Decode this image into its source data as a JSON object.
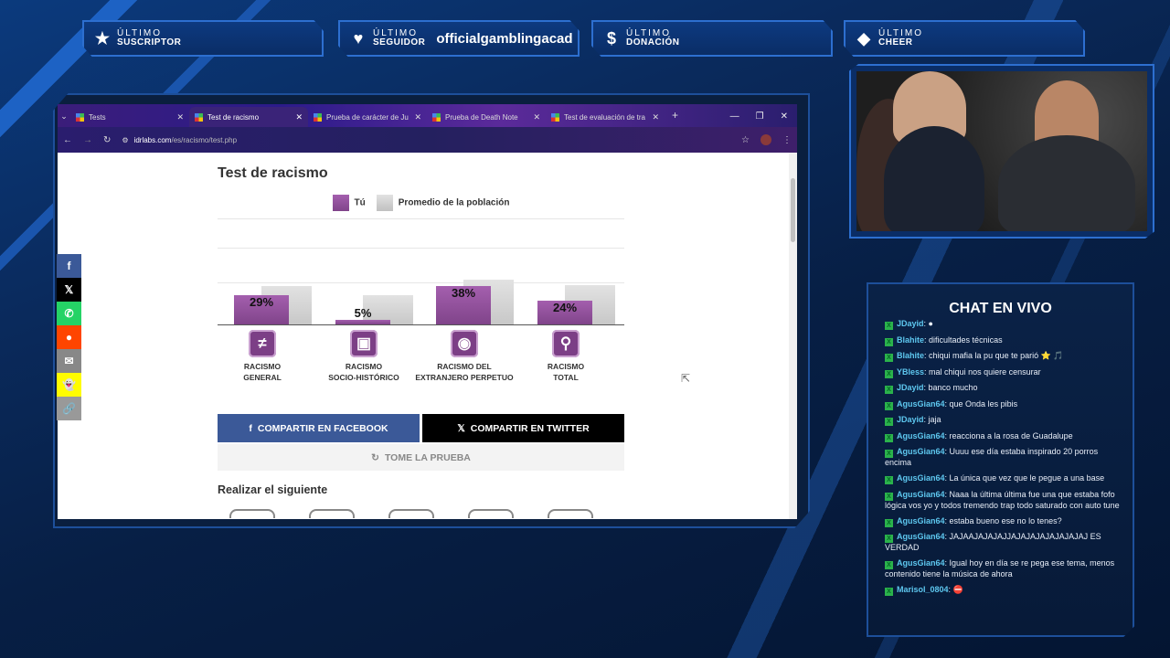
{
  "overlay": {
    "stats": [
      {
        "icon": "star-icon",
        "glyph": "★",
        "line1": "ÚLTIMO",
        "line2": "SUSCRIPTOR",
        "value": ""
      },
      {
        "icon": "heart-icon",
        "glyph": "♥",
        "line1": "ÚLTIMO",
        "line2": "SEGUIDOR",
        "value": "officialgamblingacad"
      },
      {
        "icon": "dollar-icon",
        "glyph": "$",
        "line1": "ÚLTIMO",
        "line2": "DONACIÓN",
        "value": ""
      },
      {
        "icon": "diamond-icon",
        "glyph": "◆",
        "line1": "ÚLTIMO",
        "line2": "CHEER",
        "value": ""
      }
    ]
  },
  "browser": {
    "tabs": [
      {
        "title": "Tests",
        "active": false
      },
      {
        "title": "Test de racismo",
        "active": true
      },
      {
        "title": "Prueba de carácter de Ju",
        "active": false
      },
      {
        "title": "Prueba de Death Note",
        "active": false
      },
      {
        "title": "Test de evaluación de tra",
        "active": false
      }
    ],
    "url_host": "idrlabs.com",
    "url_path": "/es/racismo/test.php"
  },
  "page": {
    "title": "Test de racismo",
    "legend_you": "Tú",
    "legend_avg": "Promedio de la población",
    "categories": [
      {
        "line1": "Racismo",
        "line2": "General",
        "icon": "not-equal-icon",
        "glyph": "≠"
      },
      {
        "line1": "Racismo",
        "line2": "Socio-Histórico",
        "icon": "chat-bubbles-icon",
        "glyph": "▣"
      },
      {
        "line1": "Racismo del",
        "line2": "Extranjero Perpetuo",
        "icon": "globe-icon",
        "glyph": "◉"
      },
      {
        "line1": "Racismo",
        "line2": "Total",
        "icon": "network-icon",
        "glyph": "⚲"
      }
    ],
    "share_facebook": "COMPARTIR EN FACEBOOK",
    "share_twitter": "COMPARTIR EN TWITTER",
    "retake": "TOME LA PRUEBA",
    "next_heading": "Realizar el siguiente"
  },
  "chart_data": {
    "type": "bar",
    "categories": [
      "Racismo General",
      "Racismo Socio-Histórico",
      "Racismo del Extranjero Perpetuo",
      "Racismo Total"
    ],
    "series": [
      {
        "name": "Tú",
        "values": [
          29,
          5,
          38,
          24
        ],
        "color": "#8e4c98"
      },
      {
        "name": "Promedio de la población",
        "values": [
          32,
          25,
          38,
          33
        ],
        "color": "#d0d0d0"
      }
    ],
    "labels": [
      "29%",
      "5%",
      "38%",
      "24%"
    ],
    "ylim": [
      0,
      100
    ]
  },
  "social": [
    {
      "icon": "facebook-icon",
      "glyph": "f",
      "color": "#3b5998"
    },
    {
      "icon": "x-icon",
      "glyph": "𝕏",
      "color": "#000000"
    },
    {
      "icon": "whatsapp-icon",
      "glyph": "✆",
      "color": "#25d366"
    },
    {
      "icon": "reddit-icon",
      "glyph": "●",
      "color": "#ff4500"
    },
    {
      "icon": "email-icon",
      "glyph": "✉",
      "color": "#888888"
    },
    {
      "icon": "snapchat-icon",
      "glyph": "👻",
      "color": "#fffc00"
    },
    {
      "icon": "link-icon",
      "glyph": "🔗",
      "color": "#999999"
    }
  ],
  "chat": {
    "title": "CHAT EN VIVO",
    "messages": [
      {
        "user": "JDayid",
        "text": "●"
      },
      {
        "user": "Blahite",
        "text": "dificultades técnicas"
      },
      {
        "user": "Blahite",
        "text": "chiqui mafia la pu que te parió ⭐ 🎵"
      },
      {
        "user": "YBless",
        "text": "mal chiqui nos quiere censurar"
      },
      {
        "user": "JDayid",
        "text": "banco mucho"
      },
      {
        "user": "AgusGian64",
        "text": "que Onda les pibis"
      },
      {
        "user": "JDayid",
        "text": "jaja"
      },
      {
        "user": "AgusGian64",
        "text": "reacciona a la rosa de Guadalupe"
      },
      {
        "user": "AgusGian64",
        "text": "Uuuu ese día estaba inspirado 20 porros encima"
      },
      {
        "user": "AgusGian64",
        "text": "La única que vez que le pegue a una base"
      },
      {
        "user": "AgusGian64",
        "text": "Naaa la última última fue una que estaba fofo lógica vos yo y todos tremendo trap todo saturado con auto tune"
      },
      {
        "user": "AgusGian64",
        "text": "estaba bueno ese no lo tenes?"
      },
      {
        "user": "AgusGian64",
        "text": "JAJAAJAJAJAJJAJAJAJAJAJAJAJAJ ES VERDAD"
      },
      {
        "user": "AgusGian64",
        "text": "Igual hoy en día se re pega ese tema, menos contenido tiene la música de ahora"
      },
      {
        "user": "Marisol_0804",
        "text": "⛔"
      }
    ]
  }
}
